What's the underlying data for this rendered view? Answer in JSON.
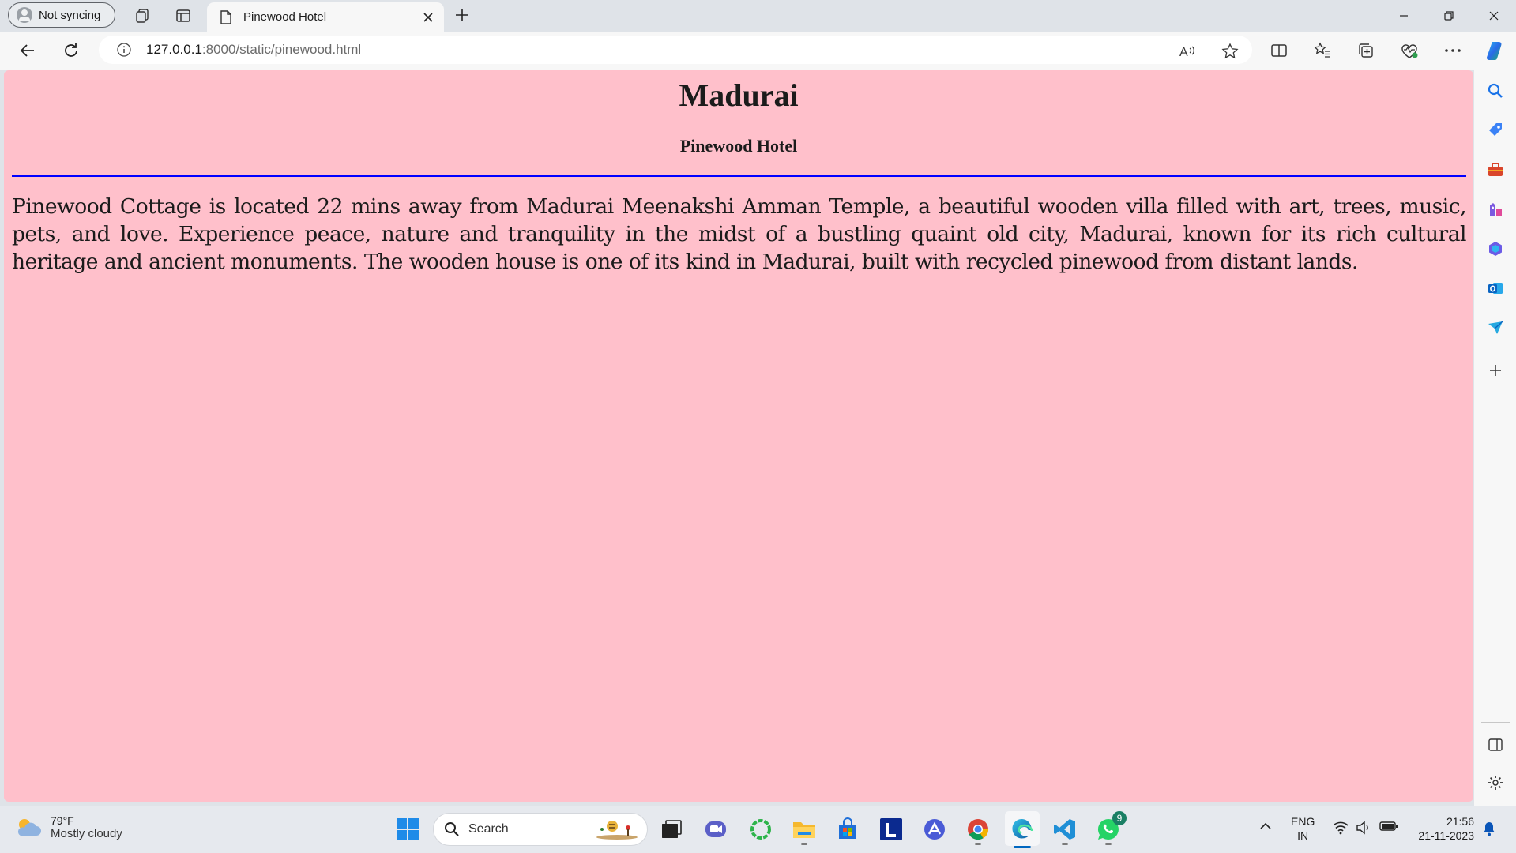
{
  "browser": {
    "profile_label": "Not syncing",
    "tab_title": "Pinewood Hotel",
    "url_host": "127.0.0.1",
    "url_path": ":8000/static/pinewood.html"
  },
  "page": {
    "heading": "Madurai",
    "subheading": "Pinewood Hotel",
    "paragraph": "Pinewood Cottage is located 22 mins away from Madurai Meenakshi Amman Temple, a beautiful wooden villa filled with art, trees, music, pets, and love. Experience peace, nature and tranquility in the midst of a bustling quaint old city, Madurai, known for its rich cultural heritage and ancient monuments. The wooden house is one of its kind in Madurai, built with recycled pinewood from distant lands.",
    "background_color": "#ffc0cb",
    "rule_color": "#0000ff"
  },
  "taskbar": {
    "weather_temp": "79°F",
    "weather_condition": "Mostly cloudy",
    "search_label": "Search",
    "lang_primary": "ENG",
    "lang_secondary": "IN",
    "time": "21:56",
    "date": "21-11-2023",
    "whatsapp_badge": "9"
  },
  "icons": {
    "tabbar": [
      "workspaces-icon",
      "vertical-tabs-icon",
      "page-icon",
      "close-icon",
      "new-tab-icon",
      "minimize-icon",
      "restore-icon",
      "window-close-icon"
    ],
    "toolbar": [
      "back-icon",
      "refresh-icon",
      "info-icon",
      "read-aloud-icon",
      "favorite-star-icon",
      "split-screen-icon",
      "favorites-icon",
      "collections-icon",
      "browser-essentials-icon",
      "more-icon",
      "copilot-icon"
    ],
    "sidebar": [
      "search-icon",
      "shopping-icon",
      "tools-icon",
      "games-icon",
      "microsoft-365-icon",
      "outlook-icon",
      "send-icon",
      "add-icon",
      "sidebar-toggle-icon",
      "settings-icon"
    ],
    "taskbar": [
      "weather-icon",
      "windows-start-icon",
      "search-icon",
      "task-view-icon",
      "teams-icon",
      "copilot-ring-icon",
      "file-explorer-icon",
      "store-icon",
      "l-app-icon",
      "vpn-app-icon",
      "chrome-icon",
      "edge-icon",
      "vscode-icon",
      "whatsapp-icon",
      "chevron-up-icon",
      "wifi-icon",
      "volume-icon",
      "battery-icon",
      "notification-bell-icon"
    ]
  }
}
